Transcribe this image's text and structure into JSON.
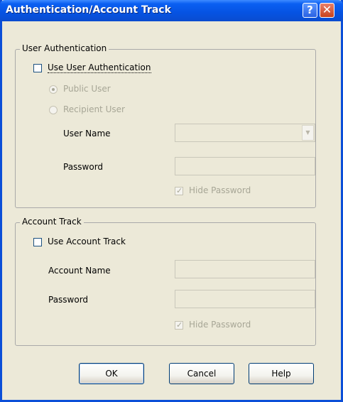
{
  "window": {
    "title": "Authentication/Account Track",
    "help_glyph": "?",
    "close_glyph": "✕"
  },
  "user_auth": {
    "legend": "User Authentication",
    "use_label": "Use User Authentication",
    "use_checked": false,
    "public_user": "Public User",
    "public_selected": true,
    "recipient_user": "Recipient User",
    "user_name_label": "User Name",
    "user_name_value": "",
    "password_label": "Password",
    "password_value": "",
    "hide_password": "Hide Password",
    "hide_checked": true
  },
  "account_track": {
    "legend": "Account Track",
    "use_label": "Use Account Track",
    "use_checked": false,
    "account_name_label": "Account Name",
    "account_name_value": "",
    "password_label": "Password",
    "password_value": "",
    "hide_password": "Hide Password",
    "hide_checked": true
  },
  "buttons": {
    "ok": "OK",
    "cancel": "Cancel",
    "help": "Help"
  },
  "icons": {
    "dropdown": "chevron-down-icon",
    "checkmark": "check-icon"
  }
}
